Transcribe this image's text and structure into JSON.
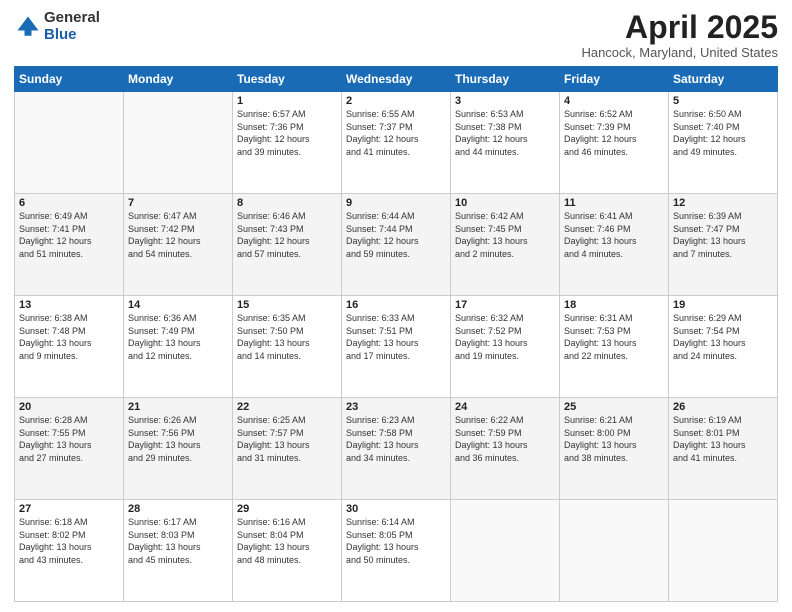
{
  "header": {
    "logo": {
      "general": "General",
      "blue": "Blue"
    },
    "title": "April 2025",
    "location": "Hancock, Maryland, United States"
  },
  "weekdays": [
    "Sunday",
    "Monday",
    "Tuesday",
    "Wednesday",
    "Thursday",
    "Friday",
    "Saturday"
  ],
  "weeks": [
    [
      {
        "day": "",
        "info": ""
      },
      {
        "day": "",
        "info": ""
      },
      {
        "day": "1",
        "info": "Sunrise: 6:57 AM\nSunset: 7:36 PM\nDaylight: 12 hours\nand 39 minutes."
      },
      {
        "day": "2",
        "info": "Sunrise: 6:55 AM\nSunset: 7:37 PM\nDaylight: 12 hours\nand 41 minutes."
      },
      {
        "day": "3",
        "info": "Sunrise: 6:53 AM\nSunset: 7:38 PM\nDaylight: 12 hours\nand 44 minutes."
      },
      {
        "day": "4",
        "info": "Sunrise: 6:52 AM\nSunset: 7:39 PM\nDaylight: 12 hours\nand 46 minutes."
      },
      {
        "day": "5",
        "info": "Sunrise: 6:50 AM\nSunset: 7:40 PM\nDaylight: 12 hours\nand 49 minutes."
      }
    ],
    [
      {
        "day": "6",
        "info": "Sunrise: 6:49 AM\nSunset: 7:41 PM\nDaylight: 12 hours\nand 51 minutes."
      },
      {
        "day": "7",
        "info": "Sunrise: 6:47 AM\nSunset: 7:42 PM\nDaylight: 12 hours\nand 54 minutes."
      },
      {
        "day": "8",
        "info": "Sunrise: 6:46 AM\nSunset: 7:43 PM\nDaylight: 12 hours\nand 57 minutes."
      },
      {
        "day": "9",
        "info": "Sunrise: 6:44 AM\nSunset: 7:44 PM\nDaylight: 12 hours\nand 59 minutes."
      },
      {
        "day": "10",
        "info": "Sunrise: 6:42 AM\nSunset: 7:45 PM\nDaylight: 13 hours\nand 2 minutes."
      },
      {
        "day": "11",
        "info": "Sunrise: 6:41 AM\nSunset: 7:46 PM\nDaylight: 13 hours\nand 4 minutes."
      },
      {
        "day": "12",
        "info": "Sunrise: 6:39 AM\nSunset: 7:47 PM\nDaylight: 13 hours\nand 7 minutes."
      }
    ],
    [
      {
        "day": "13",
        "info": "Sunrise: 6:38 AM\nSunset: 7:48 PM\nDaylight: 13 hours\nand 9 minutes."
      },
      {
        "day": "14",
        "info": "Sunrise: 6:36 AM\nSunset: 7:49 PM\nDaylight: 13 hours\nand 12 minutes."
      },
      {
        "day": "15",
        "info": "Sunrise: 6:35 AM\nSunset: 7:50 PM\nDaylight: 13 hours\nand 14 minutes."
      },
      {
        "day": "16",
        "info": "Sunrise: 6:33 AM\nSunset: 7:51 PM\nDaylight: 13 hours\nand 17 minutes."
      },
      {
        "day": "17",
        "info": "Sunrise: 6:32 AM\nSunset: 7:52 PM\nDaylight: 13 hours\nand 19 minutes."
      },
      {
        "day": "18",
        "info": "Sunrise: 6:31 AM\nSunset: 7:53 PM\nDaylight: 13 hours\nand 22 minutes."
      },
      {
        "day": "19",
        "info": "Sunrise: 6:29 AM\nSunset: 7:54 PM\nDaylight: 13 hours\nand 24 minutes."
      }
    ],
    [
      {
        "day": "20",
        "info": "Sunrise: 6:28 AM\nSunset: 7:55 PM\nDaylight: 13 hours\nand 27 minutes."
      },
      {
        "day": "21",
        "info": "Sunrise: 6:26 AM\nSunset: 7:56 PM\nDaylight: 13 hours\nand 29 minutes."
      },
      {
        "day": "22",
        "info": "Sunrise: 6:25 AM\nSunset: 7:57 PM\nDaylight: 13 hours\nand 31 minutes."
      },
      {
        "day": "23",
        "info": "Sunrise: 6:23 AM\nSunset: 7:58 PM\nDaylight: 13 hours\nand 34 minutes."
      },
      {
        "day": "24",
        "info": "Sunrise: 6:22 AM\nSunset: 7:59 PM\nDaylight: 13 hours\nand 36 minutes."
      },
      {
        "day": "25",
        "info": "Sunrise: 6:21 AM\nSunset: 8:00 PM\nDaylight: 13 hours\nand 38 minutes."
      },
      {
        "day": "26",
        "info": "Sunrise: 6:19 AM\nSunset: 8:01 PM\nDaylight: 13 hours\nand 41 minutes."
      }
    ],
    [
      {
        "day": "27",
        "info": "Sunrise: 6:18 AM\nSunset: 8:02 PM\nDaylight: 13 hours\nand 43 minutes."
      },
      {
        "day": "28",
        "info": "Sunrise: 6:17 AM\nSunset: 8:03 PM\nDaylight: 13 hours\nand 45 minutes."
      },
      {
        "day": "29",
        "info": "Sunrise: 6:16 AM\nSunset: 8:04 PM\nDaylight: 13 hours\nand 48 minutes."
      },
      {
        "day": "30",
        "info": "Sunrise: 6:14 AM\nSunset: 8:05 PM\nDaylight: 13 hours\nand 50 minutes."
      },
      {
        "day": "",
        "info": ""
      },
      {
        "day": "",
        "info": ""
      },
      {
        "day": "",
        "info": ""
      }
    ]
  ]
}
